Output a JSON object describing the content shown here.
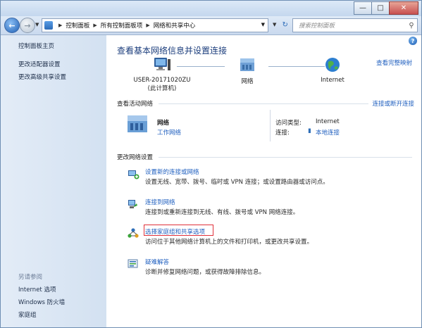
{
  "window": {
    "controls": {
      "minimize": "—",
      "maximize": "□",
      "close": "✕"
    }
  },
  "navigation": {
    "breadcrumbs": [
      "控制面板",
      "所有控制面板项",
      "网络和共享中心"
    ],
    "search_placeholder": "搜索控制面板"
  },
  "sidebar": {
    "home": "控制面板主页",
    "links": [
      "更改适配器设置",
      "更改高级共享设置"
    ],
    "see_also_title": "另请参阅",
    "see_also": [
      "Internet 选项",
      "Windows 防火墙",
      "家庭组"
    ]
  },
  "main": {
    "title": "查看基本网络信息并设置连接",
    "full_map_link": "查看完整映射",
    "map": {
      "computer_name": "USER-20171020ZU",
      "computer_sub": "(此计算机)",
      "network_label": "网络",
      "internet_label": "Internet"
    },
    "active_networks": {
      "heading": "查看活动网络",
      "connect_link": "连接或断开连接",
      "network_name": "网络",
      "network_type": "工作网络",
      "access_type_label": "访问类型:",
      "access_type_value": "Internet",
      "connections_label": "连接:",
      "connections_value": "本地连接"
    },
    "change_settings": {
      "heading": "更改网络设置",
      "tasks": [
        {
          "link": "设置新的连接或网络",
          "desc": "设置无线、宽带、拨号、临时或 VPN 连接；或设置路由器或访问点。"
        },
        {
          "link": "连接到网络",
          "desc": "连接到或重新连接到无线、有线、拨号或 VPN 网络连接。"
        },
        {
          "link": "选择家庭组和共享选项",
          "desc": "访问位于其他网络计算机上的文件和打印机，或更改共享设置。"
        },
        {
          "link": "疑难解答",
          "desc": "诊断并修复网络问题，或获得故障排除信息。"
        }
      ]
    }
  },
  "colors": {
    "link": "#1f5fbf",
    "title": "#1b3d7c",
    "highlight": "#e0303a"
  }
}
